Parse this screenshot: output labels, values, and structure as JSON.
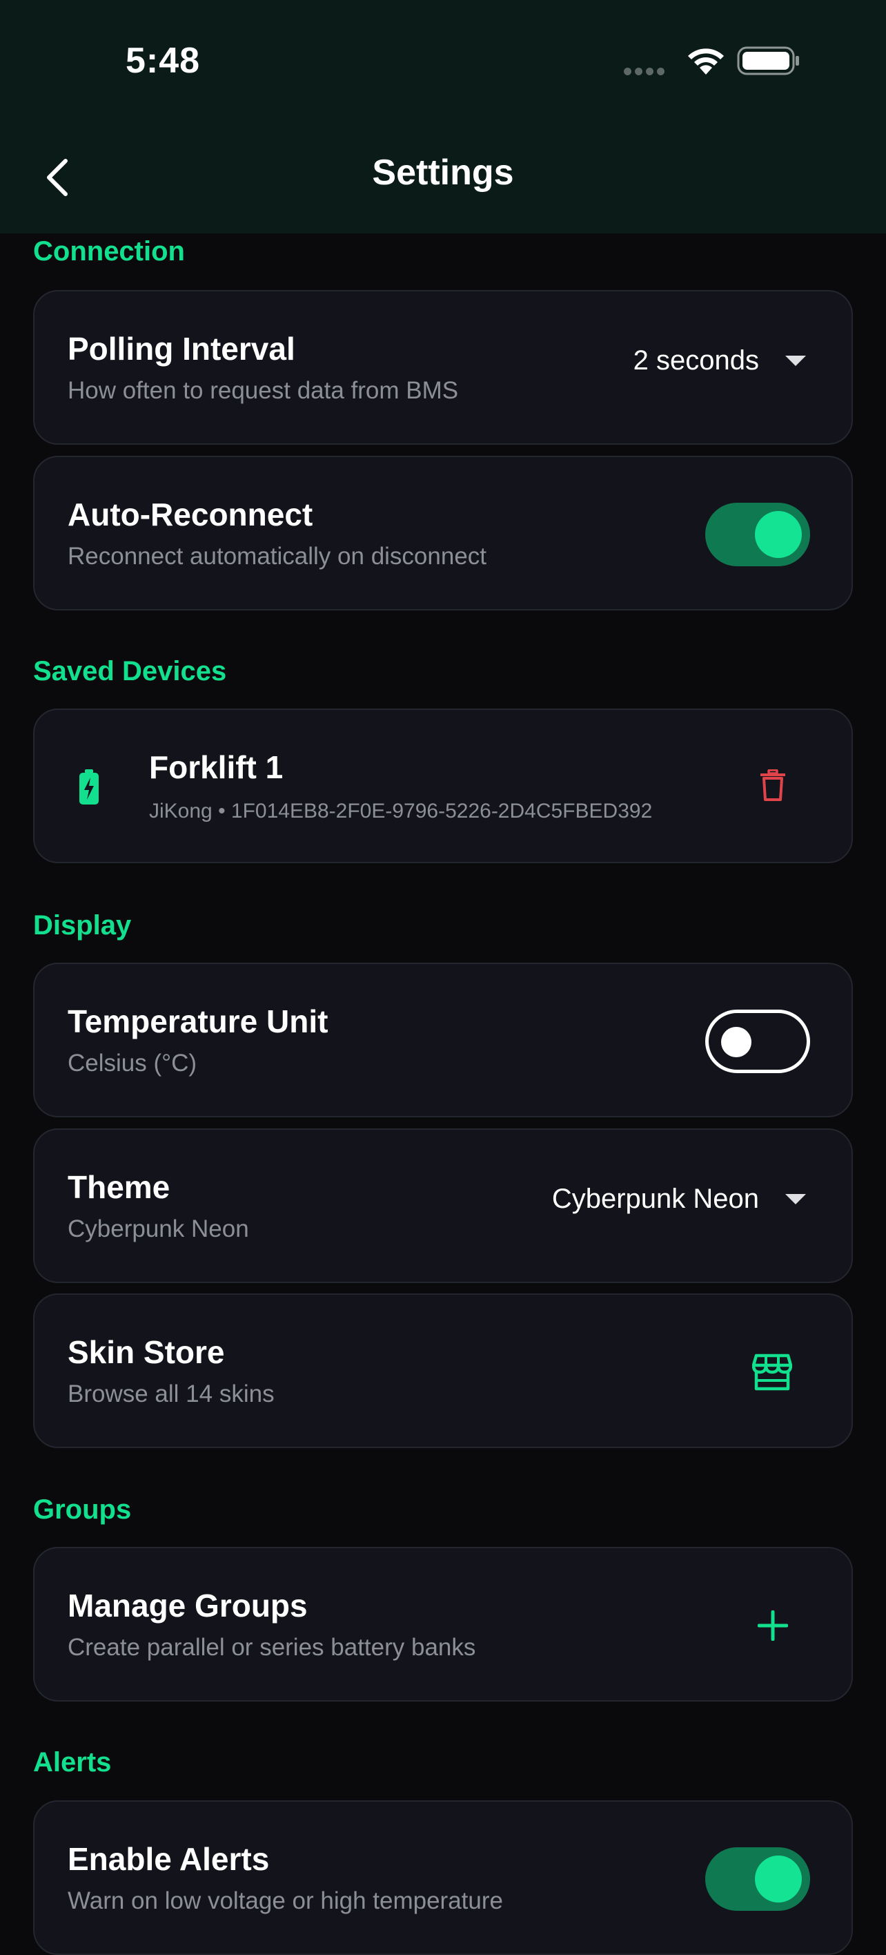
{
  "status_bar": {
    "time": "5:48",
    "icons": [
      "signal-dots-icon",
      "wifi-icon",
      "battery-icon"
    ]
  },
  "nav": {
    "back_icon": "chevron-left-icon",
    "title": "Settings"
  },
  "colors": {
    "accent": "#12e08e",
    "danger": "#e0444a",
    "card_bg": "#13141b",
    "header_bg": "#0b1b18"
  },
  "sections": {
    "connection": {
      "title": "Connection",
      "polling": {
        "label": "Polling Interval",
        "description": "How often to request data from BMS",
        "value": "2 seconds"
      },
      "auto_reconnect": {
        "label": "Auto-Reconnect",
        "description": "Reconnect automatically on disconnect",
        "enabled": true
      }
    },
    "saved_devices": {
      "title": "Saved Devices",
      "device": {
        "name": "Forklift 1",
        "details": "JiKong • 1F014EB8-2F0E-9796-5226-2D4C5FBED392",
        "icon": "battery-charging-icon",
        "action_icon": "trash-icon"
      }
    },
    "display": {
      "title": "Display",
      "temperature": {
        "label": "Temperature Unit",
        "description": "Celsius (°C)",
        "enabled": false
      },
      "theme": {
        "label": "Theme",
        "description": "Cyberpunk Neon",
        "value": "Cyberpunk Neon"
      },
      "skin_store": {
        "label": "Skin Store",
        "description": "Browse all 14 skins",
        "icon": "store-icon"
      }
    },
    "groups": {
      "title": "Groups",
      "manage": {
        "label": "Manage Groups",
        "description": "Create parallel or series battery banks",
        "icon": "plus-icon"
      }
    },
    "alerts": {
      "title": "Alerts",
      "enable": {
        "label": "Enable Alerts",
        "description": "Warn on low voltage or high temperature",
        "enabled": true
      }
    }
  }
}
